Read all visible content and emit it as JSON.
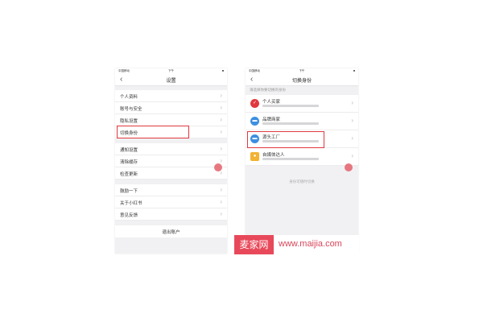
{
  "left": {
    "status": {
      "carrier": "中国移动",
      "time": "下午",
      "battery": "■"
    },
    "back": "‹",
    "title": "设置",
    "groups": [
      {
        "items": [
          "个人资料",
          "账号与安全",
          "隐私设置",
          "切换身份"
        ]
      },
      {
        "items": [
          "通知设置",
          "清除缓存",
          "检查更新"
        ]
      },
      {
        "items": [
          "鼓励一下",
          "关于小红书",
          "意见反馈"
        ]
      }
    ],
    "logout": "退出账户",
    "chevron": "›"
  },
  "right": {
    "status": {
      "carrier": "中国移动",
      "time": "下午",
      "battery": "■"
    },
    "back": "‹",
    "title": "切换身份",
    "subheader": "请选择你要切换的身份",
    "items": [
      {
        "title": "个人买家",
        "icon": "check-badge-icon",
        "color": "#e0383e"
      },
      {
        "title": "品牌商家",
        "icon": "shop-icon",
        "color": "#3d8fe0"
      },
      {
        "title": "源头工厂",
        "icon": "factory-icon",
        "color": "#3d8fe0"
      },
      {
        "title": "自媒体达人",
        "icon": "person-icon",
        "color": "#f2b233"
      }
    ],
    "note": "身份可随时切换",
    "chevron": "›"
  },
  "colors": {
    "highlight": "#e0383e",
    "touch": "#e4606a",
    "watermark": "#e8495a"
  },
  "watermark": {
    "brand": "麦家网",
    "url": "www.maijia.com"
  }
}
